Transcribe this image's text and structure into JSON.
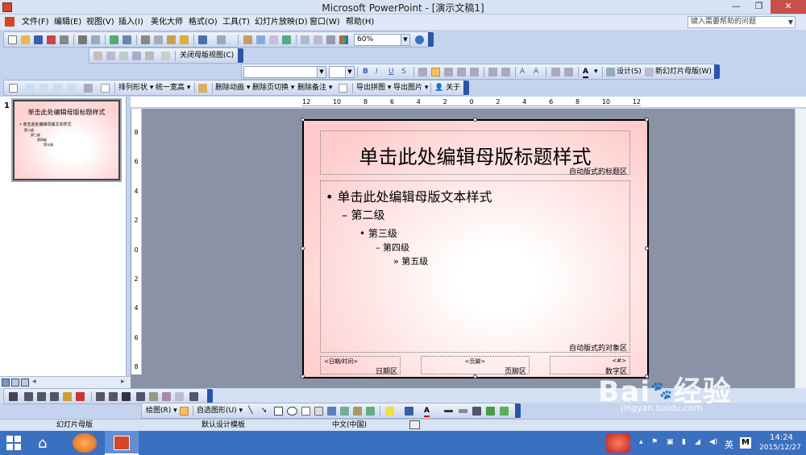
{
  "window": {
    "title": "Microsoft PowerPoint - [演示文稿1]"
  },
  "menu": {
    "items": [
      "文件(F)",
      "编辑(E)",
      "视图(V)",
      "插入(I)",
      "美化大师",
      "格式(O)",
      "工具(T)",
      "幻灯片放映(D)",
      "窗口(W)",
      "帮助(H)"
    ],
    "help_placeholder": "键入需要帮助的问题"
  },
  "toolbar_standard": {
    "zoom": "60%"
  },
  "toolbar_master_view": {
    "close_label": "关闭母版视图(C)"
  },
  "toolbar_format": {
    "design": "设计(S)",
    "new_master": "新幻灯片母版(W)"
  },
  "toolbar_addin": {
    "items": [
      "排列形状",
      "统一宽高",
      "删除动画",
      "删除页切换",
      "删除备注",
      "导出拼图",
      "导出图片",
      "关于"
    ]
  },
  "ruler": {
    "h_labels": [
      "12",
      "10",
      "8",
      "6",
      "4",
      "2",
      "0",
      "2",
      "4",
      "6",
      "8",
      "10",
      "12"
    ],
    "v_labels": [
      "8",
      "6",
      "4",
      "2",
      "0",
      "2",
      "4",
      "6",
      "8"
    ]
  },
  "slide_panel": {
    "number": "1"
  },
  "slide": {
    "title": "单击此处编辑母版标题样式",
    "title_area": "自动版式的标题区",
    "body_l1": "单击此处编辑母版文本样式",
    "body_l2": "第二级",
    "body_l3": "第三级",
    "body_l4": "第四级",
    "body_l5": "第五级",
    "object_area": "自动版式的对象区",
    "date_placeholder": "<日期/时间>",
    "date_area": "日期区",
    "footer_placeholder": "<页脚>",
    "footer_area": "页脚区",
    "number_placeholder": "<#>",
    "number_area": "数字区"
  },
  "drawing_toolbar": {
    "draw": "绘图(R)",
    "autoshape": "自选图形(U)"
  },
  "status": {
    "view": "幻灯片母版",
    "template": "默认设计模板",
    "language": "中文(中国)"
  },
  "taskbar": {
    "ime": "英",
    "time": "14:24",
    "date": "2015/12/27"
  },
  "watermark": {
    "brand": "Bai",
    "brand2": "经验",
    "url": "jingyan.baidu.com"
  },
  "colors": {
    "accent": "#2a56a8",
    "slide_bg": "#ffcaca",
    "taskbar": "#3b6fc0"
  }
}
